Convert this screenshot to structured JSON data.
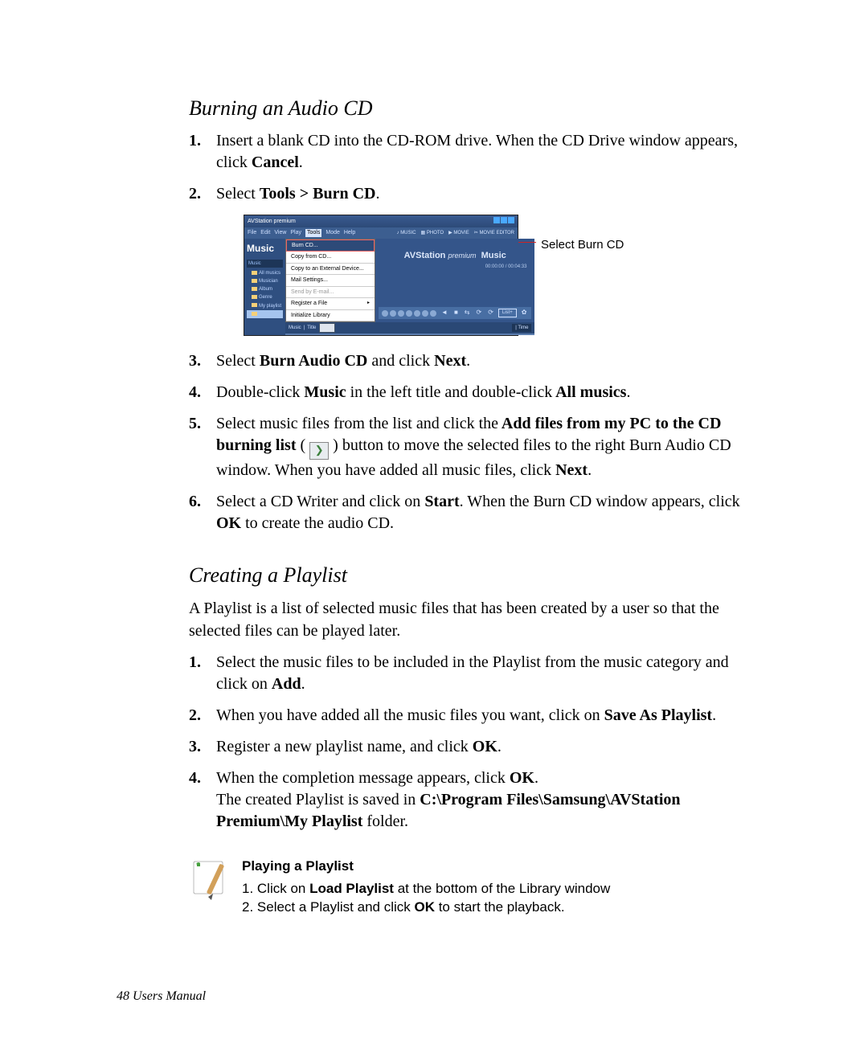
{
  "section1": {
    "heading": "Burning an Audio CD",
    "step1": {
      "num": "1.",
      "pre": "Insert a ",
      "a": "blank CD into the CD-ROM drive. When the",
      "b": " CD Drive ",
      "c": "window appears, click ",
      "bold": "Cancel",
      "post": "."
    },
    "step2": {
      "num": "2.",
      "pre": "Select ",
      "bold": "Tools > Burn CD",
      "post": "."
    },
    "step3": {
      "num": "3.",
      "pre": "Select ",
      "b1": "Burn Audio CD",
      "mid": " and click ",
      "b2": "Next",
      "post": "."
    },
    "step4": {
      "num": "4.",
      "pre": "Double-click ",
      "b1": "Music",
      "mid": " in the ",
      "a": "left title and double-click",
      "b": " All musics",
      "post": "."
    },
    "step5": {
      "num": "5.",
      "pre": "Select ",
      "a": "music files from the list and click the",
      "b1": " Add files from my PC to the CD burning list",
      "paren_open": " ( ",
      "paren_close": " ) ",
      "c": "button to move the selected files to the right",
      "d": " Burn Audio CD ",
      "e": "window. When you have added all music files, click ",
      "b2": "Next",
      "post": "."
    },
    "step6": {
      "num": "6.",
      "pre": "Select a ",
      "a": "CD Writer and click on",
      "b1": " Start",
      "mid": ". When the ",
      "b": "Burn CD window appears, click",
      "b2": " OK",
      "post": " to create the audio CD."
    }
  },
  "callout": {
    "label": "Select Burn CD"
  },
  "app": {
    "title": "AVStation premium",
    "menubar_left": [
      "File",
      "Edit",
      "View",
      "Play",
      "Tools",
      "Mode",
      "Help"
    ],
    "menubar_right": [
      "MUSIC",
      "PHOTO",
      "MOVIE",
      "MOVIE EDITOR"
    ],
    "sidebar_header": "Music",
    "sidebar_category": "Music",
    "sidebar_items": [
      "All musics",
      "Musician",
      "Album",
      "Genre",
      "My playlist"
    ],
    "sidebar_items_sel": "",
    "dropdown": [
      "Burn CD...",
      "Copy from CD...",
      "Copy to an External Device...",
      "Mail Settings...",
      "Send by E-mail...",
      "Register a File",
      "Initialize Library"
    ],
    "promo_title_a": "AVStation",
    "promo_title_b": "premium",
    "promo_title_c": "Music",
    "promo_sub": "00:00:00 / 00:04:33",
    "status_tabs": [
      "Music",
      "Title"
    ],
    "status_right": "Time",
    "ctrls_box": "List+"
  },
  "section2": {
    "heading": "Creating a Playlist",
    "intro": "A Playlist is a list of selected music files that has been created by a user so that the selected files can be played later.",
    "step1": {
      "num": "1.",
      "pre": "Select the music files to be included in the Playlist from the ",
      "a": "music category and click on ",
      "b1": "Add",
      "post": "."
    },
    "step2": {
      "num": "2.",
      "pre": "When you have added all the ",
      "a": "music files you want, click on ",
      "b1": "Save As Playlist",
      "post": "."
    },
    "step3": {
      "num": "3.",
      "text": "Register a new playlist name, and click ",
      "b1": "OK",
      "post": "."
    },
    "step4": {
      "num": "4.",
      "pre": "When the ",
      "a": "completion message appears, click ",
      "b1": "OK",
      "post1": ".",
      "line2a": "The created Playlist is saved in ",
      "b2": "C:\\Program Files\\Samsung\\AVStation Premium\\My Playlist",
      "post2": " folder."
    }
  },
  "note": {
    "heading": "Playing a Playlist",
    "l1a": "1. Click on ",
    "l1b": "Load Playlist",
    "l1c": " at the bottom of the Library window",
    "l2a": "2. Select a Playlist and click ",
    "l2b": "OK",
    "l2c": " to start the playback."
  },
  "footer": "48  Users Manual"
}
